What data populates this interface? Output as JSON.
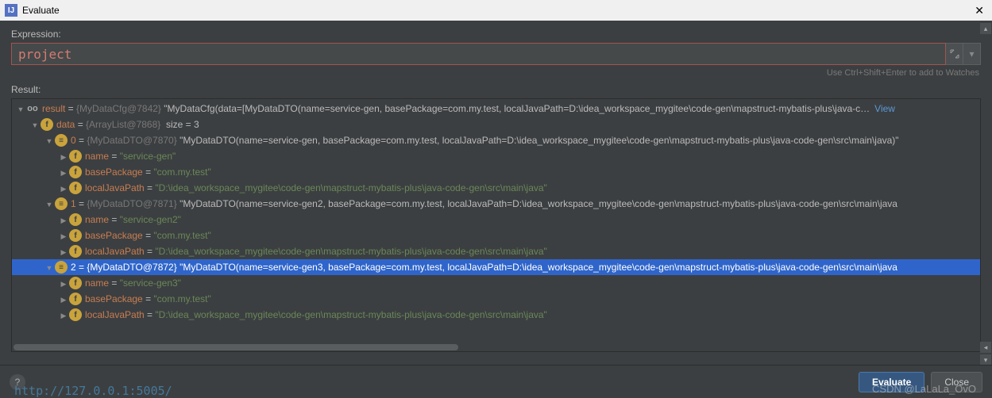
{
  "window": {
    "title": "Evaluate"
  },
  "labels": {
    "expression": "Expression:",
    "result": "Result:",
    "hint": "Use Ctrl+Shift+Enter to add to Watches"
  },
  "expression": {
    "value": "project"
  },
  "buttons": {
    "evaluate": "Evaluate",
    "close": "Close"
  },
  "links": {
    "view": "View"
  },
  "tree": {
    "root": {
      "name": "result",
      "type": "{MyDataCfg@7842}",
      "preview": "\"MyDataCfg(data=[MyDataDTO(name=service-gen, basePackage=com.my.test, localJavaPath=D:\\idea_workspace_mygitee\\code-gen\\mapstruct-mybatis-plus\\java-c…"
    },
    "data": {
      "name": "data",
      "type": "{ArrayList@7868}",
      "size": "size = 3"
    },
    "items": [
      {
        "idx": "0",
        "type": "{MyDataDTO@7870}",
        "preview": "\"MyDataDTO(name=service-gen, basePackage=com.my.test, localJavaPath=D:\\idea_workspace_mygitee\\code-gen\\mapstruct-mybatis-plus\\java-code-gen\\src\\main\\java)\"",
        "fields": {
          "name": "\"service-gen\"",
          "basePackage": "\"com.my.test\"",
          "localJavaPath": "\"D:\\idea_workspace_mygitee\\code-gen\\mapstruct-mybatis-plus\\java-code-gen\\src\\main\\java\""
        }
      },
      {
        "idx": "1",
        "type": "{MyDataDTO@7871}",
        "preview": "\"MyDataDTO(name=service-gen2, basePackage=com.my.test, localJavaPath=D:\\idea_workspace_mygitee\\code-gen\\mapstruct-mybatis-plus\\java-code-gen\\src\\main\\java",
        "fields": {
          "name": "\"service-gen2\"",
          "basePackage": "\"com.my.test\"",
          "localJavaPath": "\"D:\\idea_workspace_mygitee\\code-gen\\mapstruct-mybatis-plus\\java-code-gen\\src\\main\\java\""
        }
      },
      {
        "idx": "2",
        "type": "{MyDataDTO@7872}",
        "preview": "\"MyDataDTO(name=service-gen3, basePackage=com.my.test, localJavaPath=D:\\idea_workspace_mygitee\\code-gen\\mapstruct-mybatis-plus\\java-code-gen\\src\\main\\java",
        "fields": {
          "name": "\"service-gen3\"",
          "basePackage": "\"com.my.test\"",
          "localJavaPath": "\"D:\\idea_workspace_mygitee\\code-gen\\mapstruct-mybatis-plus\\java-code-gen\\src\\main\\java\""
        }
      }
    ]
  },
  "fieldKeys": {
    "name": "name",
    "basePackage": "basePackage",
    "localJavaPath": "localJavaPath"
  },
  "watermark": "CSDN @LaLaLa_OvO",
  "background_url": "http://127.0.0.1:5005/"
}
